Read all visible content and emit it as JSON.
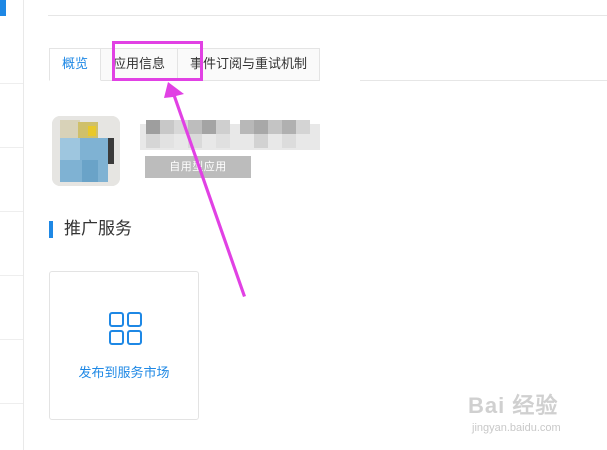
{
  "tabs": [
    {
      "label": "概览",
      "active": true
    },
    {
      "label": "应用信息",
      "active": false
    },
    {
      "label": "事件订阅与重试机制",
      "active": false
    }
  ],
  "app": {
    "status_badge": "自用型应用"
  },
  "section": {
    "title": "推广服务"
  },
  "card": {
    "label": "发布到服务市场",
    "icon": "grid-icon"
  },
  "watermark": {
    "main": "Bai 经验",
    "sub": "jingyan.baidu.com"
  },
  "colors": {
    "accent": "#1e88e5",
    "annotation": "#e141e4"
  }
}
